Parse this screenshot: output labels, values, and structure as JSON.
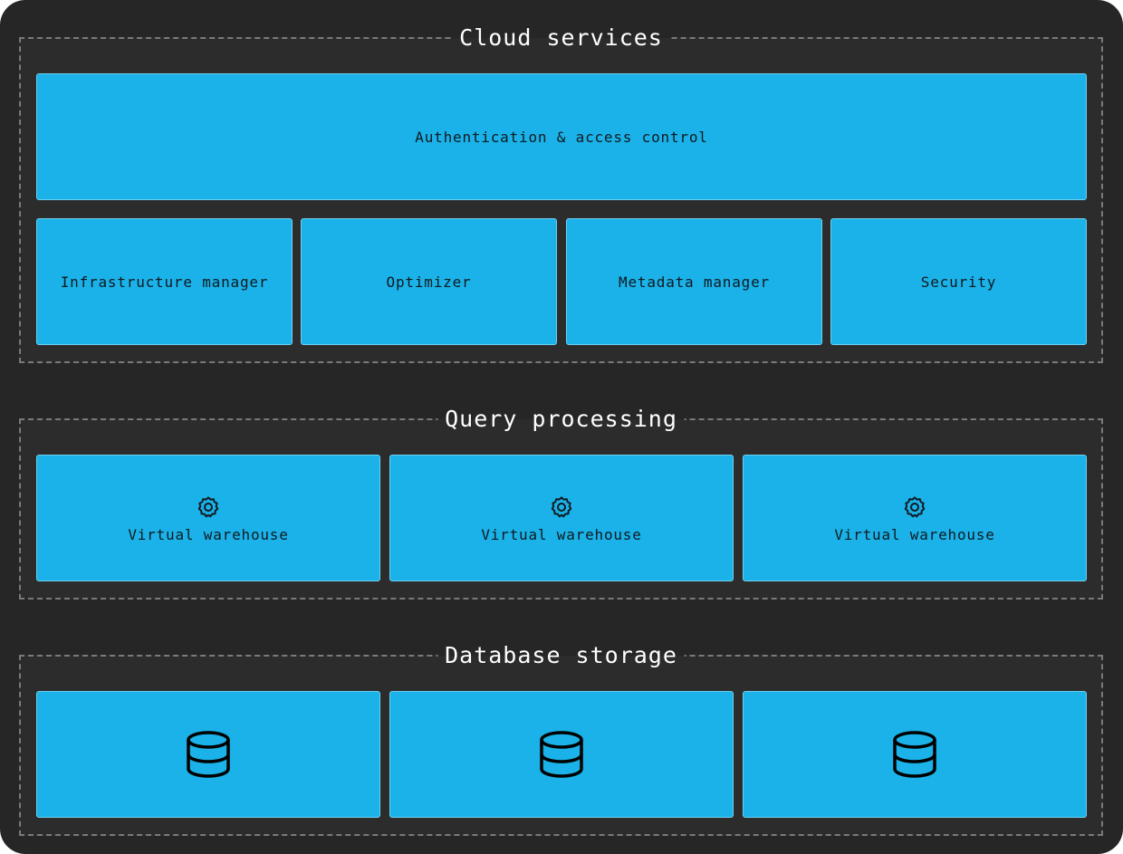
{
  "sections": [
    {
      "title": "Cloud services",
      "top_box": {
        "label": "Authentication & access control"
      },
      "boxes": [
        {
          "label": "Infrastructure manager"
        },
        {
          "label": "Optimizer"
        },
        {
          "label": "Metadata manager"
        },
        {
          "label": "Security"
        }
      ]
    },
    {
      "title": "Query processing",
      "boxes": [
        {
          "label": "Virtual warehouse",
          "icon": "gear-icon"
        },
        {
          "label": "Virtual warehouse",
          "icon": "gear-icon"
        },
        {
          "label": "Virtual warehouse",
          "icon": "gear-icon"
        }
      ]
    },
    {
      "title": "Database storage",
      "boxes": [
        {
          "icon": "database-icon"
        },
        {
          "icon": "database-icon"
        },
        {
          "icon": "database-icon"
        }
      ]
    }
  ],
  "colors": {
    "background": "#262626",
    "panel": "#2c2c2c",
    "box": "#1ab2e8",
    "dashed_border": "#7a7a7a"
  }
}
